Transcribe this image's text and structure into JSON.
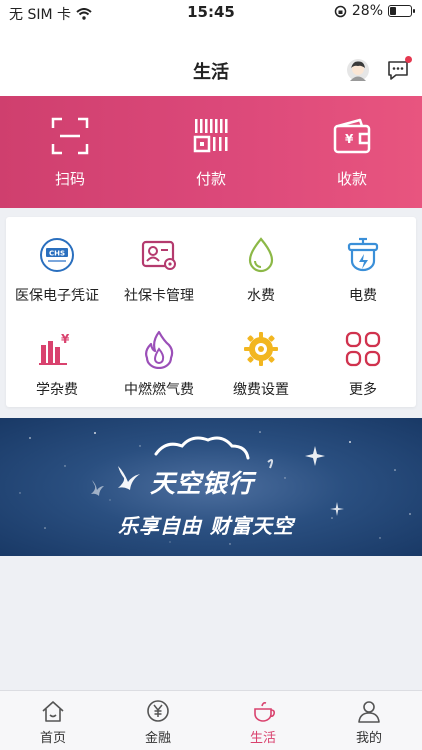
{
  "status_bar": {
    "carrier": "无 SIM 卡",
    "time": "15:45",
    "battery": "28%"
  },
  "header": {
    "title": "生活"
  },
  "quick_actions": [
    {
      "label": "扫码",
      "icon": "scan-icon"
    },
    {
      "label": "付款",
      "icon": "payment-code-icon"
    },
    {
      "label": "收款",
      "icon": "wallet-icon"
    }
  ],
  "services": [
    {
      "label": "医保电子凭证",
      "icon": "chs-medical-insurance-icon"
    },
    {
      "label": "社保卡管理",
      "icon": "social-security-card-icon"
    },
    {
      "label": "水费",
      "icon": "water-drop-icon"
    },
    {
      "label": "电费",
      "icon": "electricity-icon"
    },
    {
      "label": "学杂费",
      "icon": "tuition-icon"
    },
    {
      "label": "中燃燃气费",
      "icon": "gas-flame-icon"
    },
    {
      "label": "缴费设置",
      "icon": "payment-settings-icon"
    },
    {
      "label": "更多",
      "icon": "more-grid-icon"
    }
  ],
  "chs_badge": "CHS",
  "banner": {
    "brand": "天空银行",
    "slogan": "乐享自由  财富天空"
  },
  "tabs": [
    {
      "label": "首页",
      "icon": "home-icon",
      "active": false
    },
    {
      "label": "金融",
      "icon": "finance-yuan-icon",
      "active": false
    },
    {
      "label": "生活",
      "icon": "life-teapot-icon",
      "active": true
    },
    {
      "label": "我的",
      "icon": "profile-icon",
      "active": false
    }
  ],
  "colors": {
    "accent": "#d9426e",
    "hero_start": "#cf3f6e",
    "hero_end": "#e8557f",
    "banner": "#2a4f80"
  }
}
